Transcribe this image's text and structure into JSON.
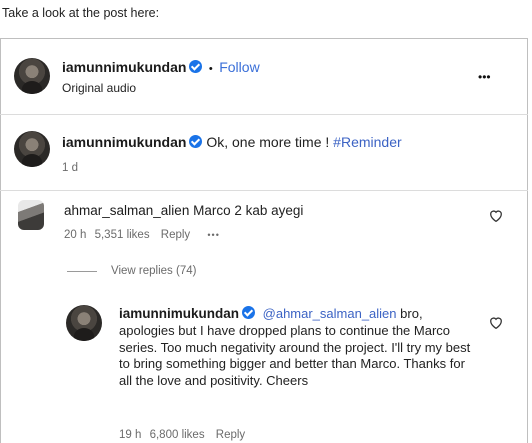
{
  "caption": "Take a look at the post here:",
  "post": {
    "username": "iamunnimukundan",
    "separator": "•",
    "follow_label": "Follow",
    "audio_label": "Original audio",
    "more_label": "•••"
  },
  "author_comment": {
    "username": "iamunnimukundan",
    "text": "Ok, one more time !",
    "hashtag": "#Reminder",
    "time": "1 d"
  },
  "comment": {
    "username": "ahmar_salman_alien",
    "text": "Marco 2 kab ayegi",
    "time": "20 h",
    "likes": "5,351 likes",
    "reply_label": "Reply",
    "more_label": "•••",
    "view_replies": "View replies (74)"
  },
  "reply": {
    "username": "iamunnimukundan",
    "mention": "@ahmar_salman_alien",
    "text": "bro, apologies but I have dropped plans to continue the Marco series. Too much negativity around the project. I'll try my best to bring something bigger and better than Marco. Thanks for all the love and positivity. Cheers",
    "time": "19 h",
    "likes": "6,800 likes",
    "reply_label": "Reply"
  },
  "icons": {
    "verified": "verified-badge-icon",
    "like": "heart-icon",
    "more": "more-options-icon"
  },
  "colors": {
    "verified": "#1a73e8",
    "link": "#3c63c4",
    "follow": "#3a6fd8"
  }
}
